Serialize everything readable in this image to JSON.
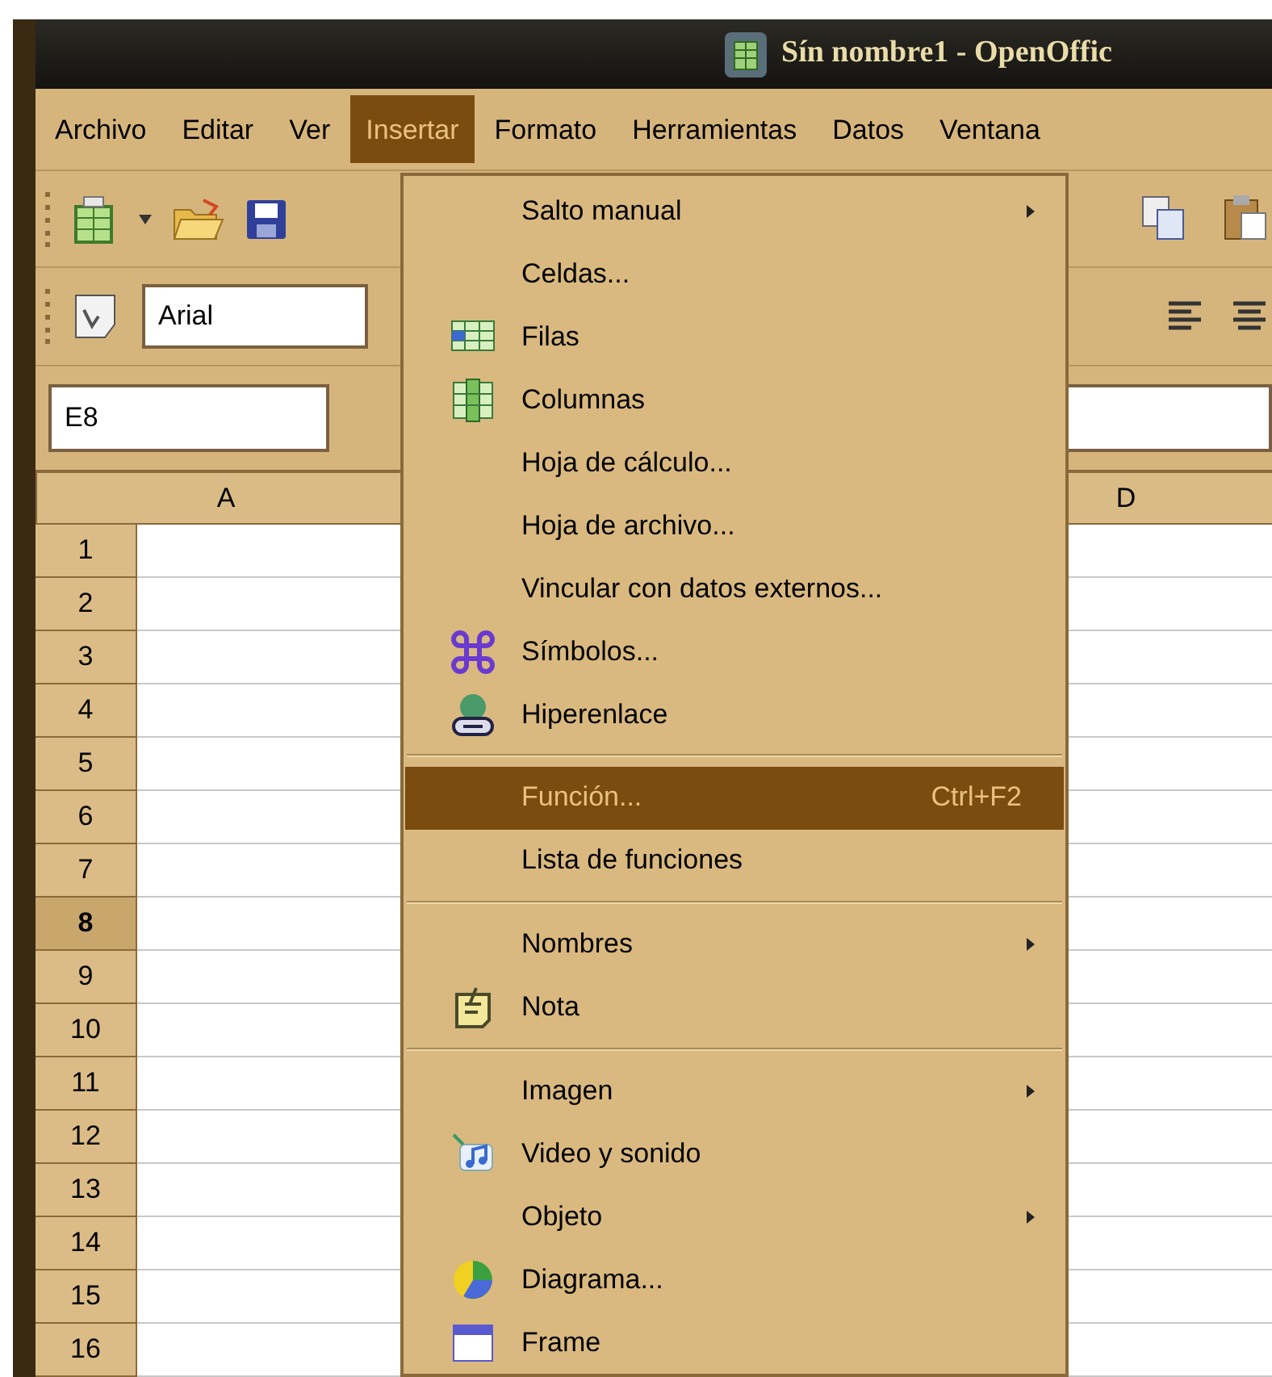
{
  "window": {
    "title": "Sín nombre1 - OpenOffic"
  },
  "menu_bar": [
    {
      "label": "Archivo",
      "selected": false
    },
    {
      "label": "Editar",
      "selected": false
    },
    {
      "label": "Ver",
      "selected": false
    },
    {
      "label": "Insertar",
      "selected": true
    },
    {
      "label": "Formato",
      "selected": false
    },
    {
      "label": "Herramientas",
      "selected": false
    },
    {
      "label": "Datos",
      "selected": false
    },
    {
      "label": "Ventana",
      "selected": false
    }
  ],
  "font_name": {
    "value": "Arial"
  },
  "name_box": {
    "value": "E8"
  },
  "columns": [
    "A",
    "D"
  ],
  "rows": [
    {
      "label": "1",
      "selected": false
    },
    {
      "label": "2",
      "selected": false
    },
    {
      "label": "3",
      "selected": false
    },
    {
      "label": "4",
      "selected": false
    },
    {
      "label": "5",
      "selected": false
    },
    {
      "label": "6",
      "selected": false
    },
    {
      "label": "7",
      "selected": false
    },
    {
      "label": "8",
      "selected": true
    },
    {
      "label": "9",
      "selected": false
    },
    {
      "label": "10",
      "selected": false
    },
    {
      "label": "11",
      "selected": false
    },
    {
      "label": "12",
      "selected": false
    },
    {
      "label": "13",
      "selected": false
    },
    {
      "label": "14",
      "selected": false
    },
    {
      "label": "15",
      "selected": false
    },
    {
      "label": "16",
      "selected": false
    }
  ],
  "insert_menu": [
    {
      "kind": "item",
      "label": "Salto manual",
      "submenu": true,
      "selected": false
    },
    {
      "kind": "item",
      "label": "Celdas...",
      "submenu": false,
      "selected": false
    },
    {
      "kind": "item",
      "label": "Filas",
      "submenu": false,
      "selected": false
    },
    {
      "kind": "item",
      "label": "Columnas",
      "submenu": false,
      "selected": false
    },
    {
      "kind": "item",
      "label": "Hoja de cálculo...",
      "submenu": false,
      "selected": false
    },
    {
      "kind": "item",
      "label": "Hoja de archivo...",
      "submenu": false,
      "selected": false
    },
    {
      "kind": "item",
      "label": "Vincular con datos externos...",
      "submenu": false,
      "selected": false
    },
    {
      "kind": "item",
      "label": "Símbolos...",
      "submenu": false,
      "selected": false
    },
    {
      "kind": "item",
      "label": "Hiperenlace",
      "submenu": false,
      "selected": false
    },
    {
      "kind": "separator"
    },
    {
      "kind": "item",
      "label": "Función...",
      "shortcut": "Ctrl+F2",
      "submenu": false,
      "selected": true
    },
    {
      "kind": "item",
      "label": "Lista de funciones",
      "submenu": false,
      "selected": false
    },
    {
      "kind": "separator"
    },
    {
      "kind": "item",
      "label": "Nombres",
      "submenu": true,
      "selected": false
    },
    {
      "kind": "item",
      "label": "Nota",
      "submenu": false,
      "selected": false
    },
    {
      "kind": "separator"
    },
    {
      "kind": "item",
      "label": "Imagen",
      "submenu": true,
      "selected": false
    },
    {
      "kind": "item",
      "label": "Video y sonido",
      "submenu": false,
      "selected": false
    },
    {
      "kind": "item",
      "label": "Objeto",
      "submenu": true,
      "selected": false
    },
    {
      "kind": "item",
      "label": "Diagrama...",
      "submenu": false,
      "selected": false
    },
    {
      "kind": "item",
      "label": "Frame",
      "submenu": false,
      "selected": false
    }
  ]
}
